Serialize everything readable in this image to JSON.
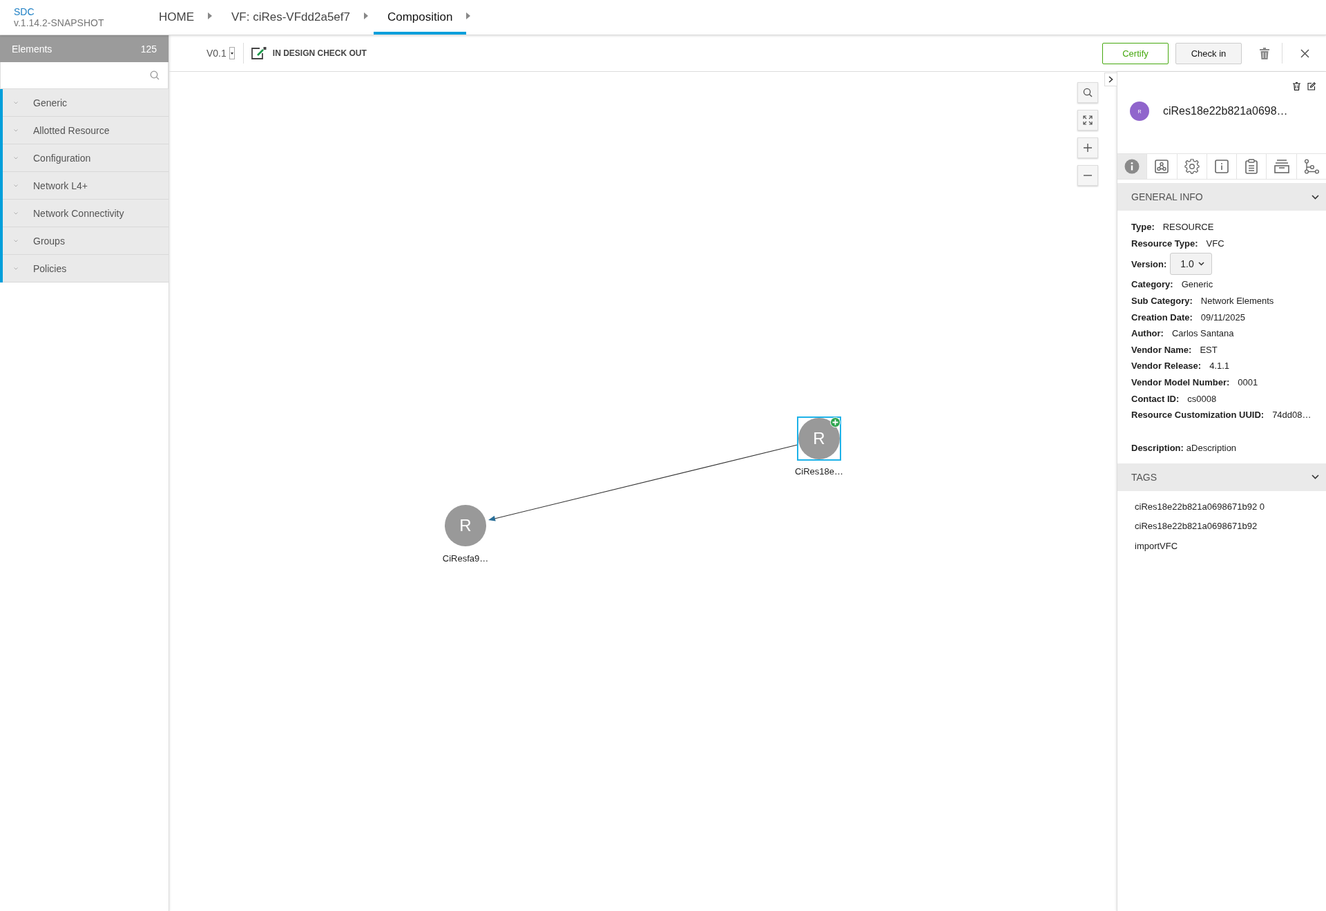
{
  "header": {
    "brand": "SDC",
    "version": "v.1.14.2-SNAPSHOT",
    "breadcrumbs": [
      {
        "label": "HOME",
        "selected": false
      },
      {
        "label": "VF: ciRes-VFdd2a5ef7",
        "selected": false
      },
      {
        "label": "Composition",
        "selected": true
      }
    ]
  },
  "sidebar": {
    "title": "Elements",
    "count": "125",
    "items": [
      {
        "label": "Generic"
      },
      {
        "label": "Allotted Resource"
      },
      {
        "label": "Configuration"
      },
      {
        "label": "Network L4+"
      },
      {
        "label": "Network Connectivity"
      },
      {
        "label": "Groups"
      },
      {
        "label": "Policies"
      }
    ]
  },
  "toolbar": {
    "version": "V0.1",
    "status": "IN DESIGN CHECK OUT",
    "buttons": [
      {
        "label": "Certify",
        "kind": "primary"
      },
      {
        "label": "Check in",
        "kind": "secondary"
      }
    ]
  },
  "canvas": {
    "nodes": [
      {
        "letter": "R",
        "label": "CiResfa9…",
        "selected": false
      },
      {
        "letter": "R",
        "label": "CiRes18e…",
        "selected": true
      }
    ]
  },
  "panel": {
    "avatar": "R",
    "name": "ciRes18e22b821a0698…",
    "tabs": [
      {
        "kind": "info-filled",
        "selected": true
      },
      {
        "kind": "network",
        "selected": false
      },
      {
        "kind": "gear",
        "selected": false
      },
      {
        "kind": "info-square",
        "selected": false
      },
      {
        "kind": "clipboard",
        "selected": false
      },
      {
        "kind": "tray",
        "selected": false
      },
      {
        "kind": "branch",
        "selected": false
      }
    ],
    "general_info": {
      "title": "GENERAL INFO",
      "fields": [
        {
          "label": "Type:",
          "value": "RESOURCE",
          "kind": "text"
        },
        {
          "label": "Resource Type:",
          "value": "VFC",
          "kind": "text"
        },
        {
          "label": "Version:",
          "value": "1.0",
          "kind": "select"
        },
        {
          "label": "Category:",
          "value": "Generic",
          "kind": "text"
        },
        {
          "label": "Sub Category:",
          "value": "Network Elements",
          "kind": "text"
        },
        {
          "label": "Creation Date:",
          "value": "09/11/2025",
          "kind": "text"
        },
        {
          "label": "Author:",
          "value": "Carlos Santana",
          "kind": "text"
        },
        {
          "label": "Vendor Name:",
          "value": "EST",
          "kind": "text"
        },
        {
          "label": "Vendor Release:",
          "value": "4.1.1",
          "kind": "text"
        },
        {
          "label": "Vendor Model Number:",
          "value": "0001",
          "kind": "text"
        },
        {
          "label": "Contact ID:",
          "value": "cs0008",
          "kind": "text"
        },
        {
          "label": "Resource Customization UUID:",
          "value": "74dd08…",
          "kind": "text"
        }
      ],
      "description": {
        "label": "Description:",
        "value": "aDescription"
      }
    },
    "tags": {
      "title": "TAGS",
      "items": [
        "ciRes18e22b821a0698671b92 0",
        "ciRes18e22b821a0698671b92",
        "importVFC"
      ]
    }
  }
}
